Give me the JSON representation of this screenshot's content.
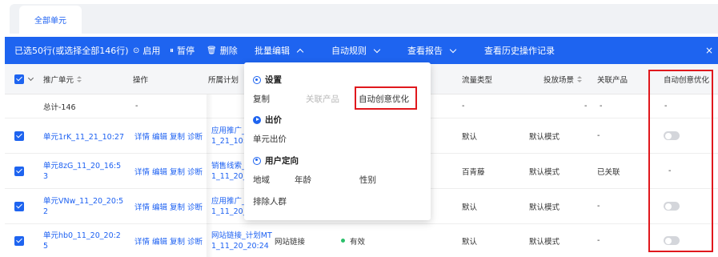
{
  "tabs": [
    {
      "label": "全部单元"
    }
  ],
  "action_bar": {
    "selection": "已选50行(或选择全部146行)",
    "enable": "启用",
    "pause": "暂停",
    "delete": "删除",
    "batch_edit": "批量编辑",
    "auto_rules": "自动规则",
    "view_report": "查看报告",
    "history": "查看历史操作记录",
    "close": "×"
  },
  "columns": {
    "unit": "推广单元",
    "ops": "操作",
    "plan": "所属计划",
    "flow": "流量类型",
    "scene": "投放场景",
    "product": "关联产品",
    "auto": "自动创意优化"
  },
  "total_row": {
    "label": "总计-146",
    "ops": "-",
    "flow": "-",
    "scene_dash": "-",
    "product_dash": "-",
    "auto": "-"
  },
  "rows": [
    {
      "unit": "单元1rK_11_21_10:27",
      "plan": "应用推广_计\n1_21_10:27",
      "flow": "默认",
      "scene": "默认模式",
      "product": "-",
      "auto": "toggle"
    },
    {
      "unit": "单元8zG_11_20_16:5\n3",
      "plan": "销售线索_计\n1_11_20_16",
      "flow": "百青藤",
      "scene": "默认模式",
      "product": "已关联",
      "auto": "-"
    },
    {
      "unit": "单元VNw_11_20_20:5\n2",
      "plan": "应用推广_计\n1_11_20_20",
      "flow": "默认",
      "scene": "默认模式",
      "product": "-",
      "auto": "toggle"
    },
    {
      "unit": "单元hb0_11_20_20:2\n5",
      "plan": "网站链接_计划MT\n1_11_20_20:24",
      "plan_type": "网站链接",
      "status": "有效",
      "flow": "默认",
      "scene": "默认模式",
      "product": "-",
      "auto": "toggle"
    }
  ],
  "row_ops": [
    "详情",
    "编辑",
    "复制",
    "诊断"
  ],
  "dropdown": {
    "settings": {
      "title": "设置",
      "items": [
        "复制",
        "关联产品",
        "自动创意优化"
      ]
    },
    "bid": {
      "title": "出价",
      "items": [
        "单元出价"
      ]
    },
    "targeting": {
      "title": "用户定向",
      "items": [
        "地域",
        "年龄",
        "性别",
        "排除人群"
      ]
    }
  },
  "colors": {
    "primary": "#1e64f0",
    "highlight": "#e0181d",
    "status_ok": "#2bbf6a"
  }
}
